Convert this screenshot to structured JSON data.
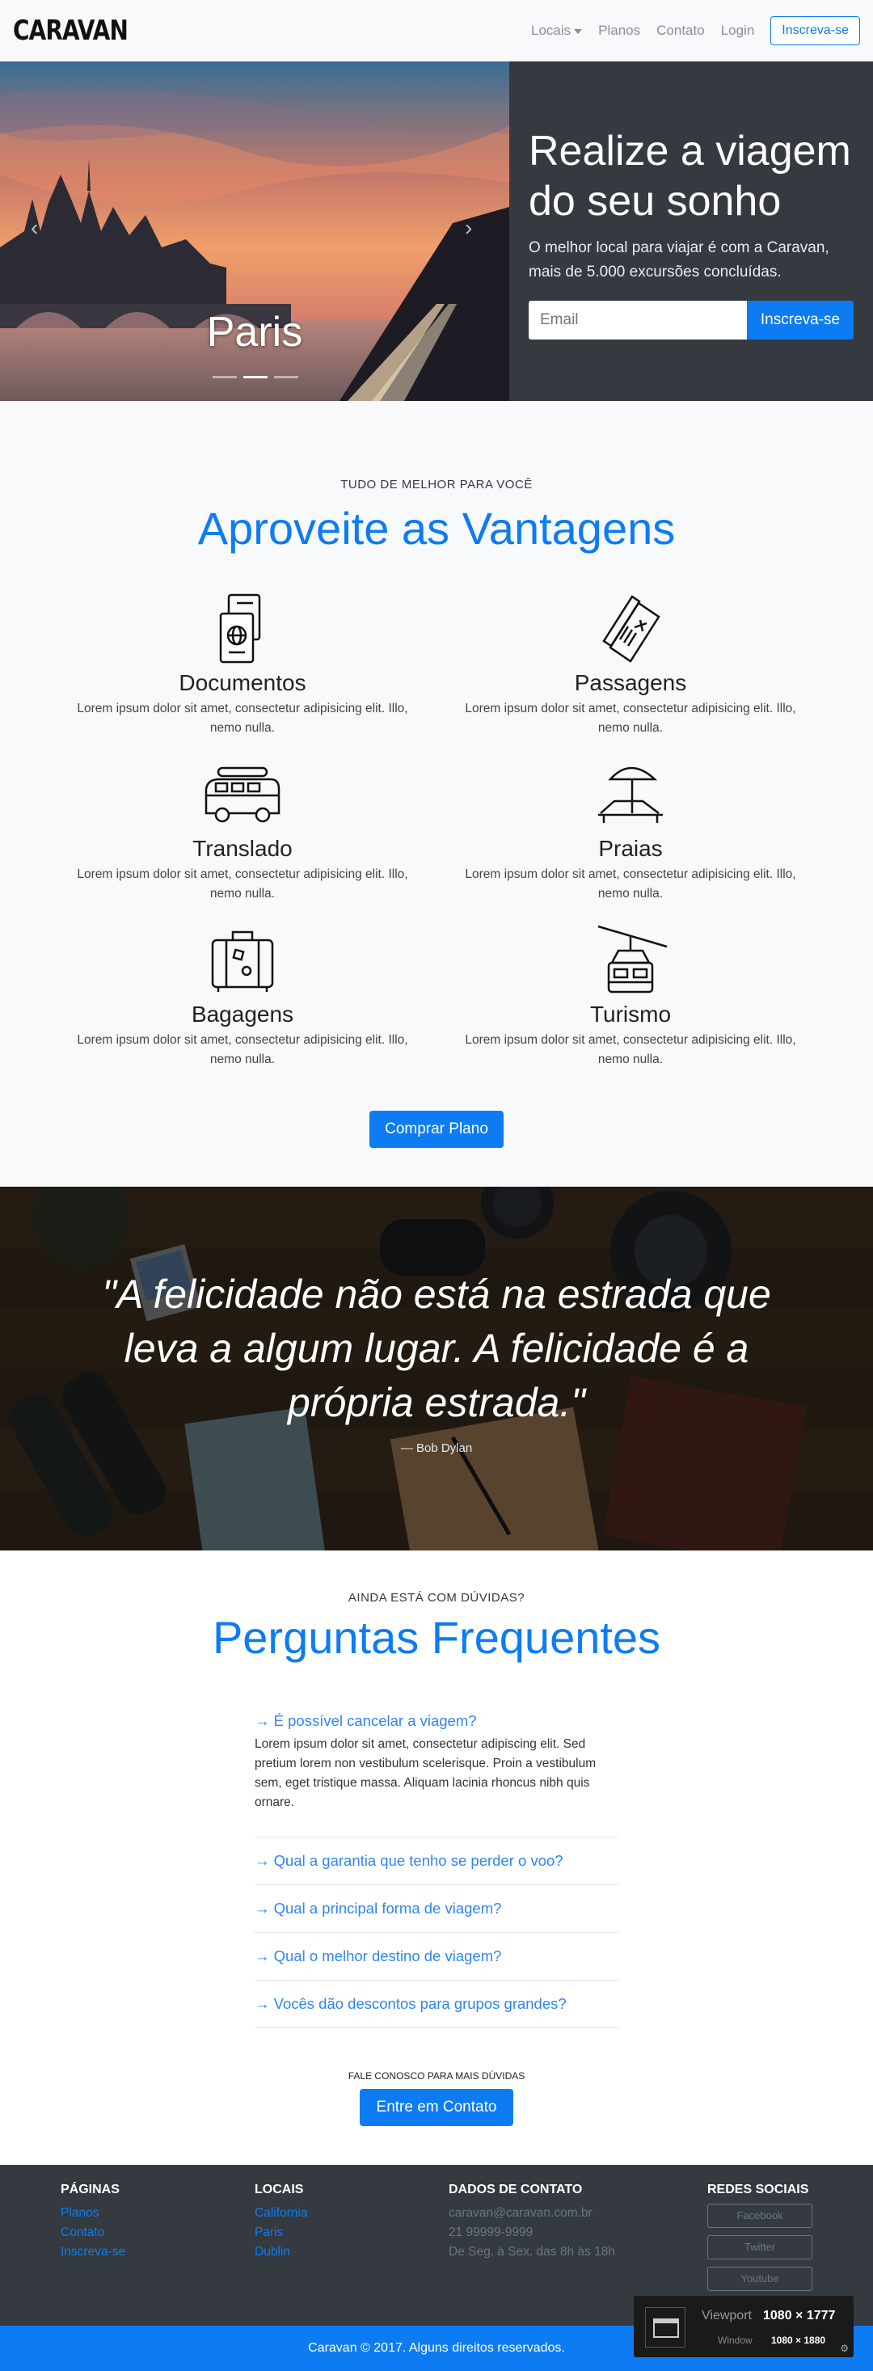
{
  "navbar": {
    "brand": "CARAVAN",
    "links": [
      "Locais",
      "Planos",
      "Contato",
      "Login"
    ],
    "cta": "Inscreva-se"
  },
  "hero": {
    "carousel_caption": "Paris",
    "title": "Realize a viagem do seu sonho",
    "subtitle": "O melhor local para viajar é com a Caravan, mais de 5.000 excursões concluídas.",
    "email_placeholder": "Email",
    "signup_button": "Inscreva-se",
    "active_slide": 2,
    "slide_count": 3
  },
  "features": {
    "tag": "TUDO DE MELHOR PARA VOCÊ",
    "title": "Aproveite as Vantagens",
    "items": [
      {
        "title": "Documentos",
        "text": "Lorem ipsum dolor sit amet, consectetur adipisicing elit. Illo, nemo nulla.",
        "icon": "passport-icon"
      },
      {
        "title": "Passagens",
        "text": "Lorem ipsum dolor sit amet, consectetur adipisicing elit. Illo, nemo nulla.",
        "icon": "ticket-icon"
      },
      {
        "title": "Translado",
        "text": "Lorem ipsum dolor sit amet, consectetur adipisicing elit. Illo, nemo nulla.",
        "icon": "van-icon"
      },
      {
        "title": "Praias",
        "text": "Lorem ipsum dolor sit amet, consectetur adipisicing elit. Illo, nemo nulla.",
        "icon": "beach-icon"
      },
      {
        "title": "Bagagens",
        "text": "Lorem ipsum dolor sit amet, consectetur adipisicing elit. Illo, nemo nulla.",
        "icon": "suitcase-icon"
      },
      {
        "title": "Turismo",
        "text": "Lorem ipsum dolor sit amet, consectetur adipisicing elit. Illo, nemo nulla.",
        "icon": "cable-car-icon"
      }
    ],
    "button": "Comprar Plano"
  },
  "quote": {
    "text": "\"A felicidade não está na estrada que leva a algum lugar. A felicidade é a própria estrada.\"",
    "author": "— Bob Dylan"
  },
  "faq": {
    "tag": "AINDA ESTÁ COM DÚVIDAS?",
    "title": "Perguntas Frequentes",
    "items": [
      {
        "q": "→ É possível cancelar a viagem?",
        "a": "Lorem ipsum dolor sit amet, consectetur adipiscing elit. Sed pretium lorem non vestibulum scelerisque. Proin a vestibulum sem, eget tristique massa. Aliquam lacinia rhoncus nibh quis ornare."
      },
      {
        "q": "→ Qual a garantia que tenho se perder o voo?",
        "a": ""
      },
      {
        "q": "→ Qual a principal forma de viagem?",
        "a": ""
      },
      {
        "q": "→ Qual o melhor destino de viagem?",
        "a": ""
      },
      {
        "q": "→ Vocês dão descontos para grupos grandes?",
        "a": ""
      }
    ],
    "contact_tag": "FALE CONOSCO PARA MAIS DÚVIDAS",
    "contact_button": "Entre em Contato"
  },
  "footer": {
    "pages": {
      "title": "PÁGINAS",
      "links": [
        "Planos",
        "Contato",
        "Inscreva-se"
      ]
    },
    "locations": {
      "title": "LOCAIS",
      "links": [
        "California",
        "Paris",
        "Dublin"
      ]
    },
    "contact": {
      "title": "DADOS DE CONTATO",
      "lines": [
        "caravan@caravan.com.br",
        "21 99999-9999",
        "De Seg. à Sex. das 8h às 18h"
      ]
    },
    "social": {
      "title": "REDES SOCIAIS",
      "links": [
        "Facebook",
        "Twitter",
        "Youtube"
      ]
    },
    "copyright": "Caravan © 2017. Alguns direitos reservados."
  },
  "viewport_overlay": {
    "viewport_label": "Viewport",
    "viewport_value": "1080 × 1777",
    "window_label": "Window",
    "window_value": "1080 × 1880"
  },
  "colors": {
    "primary": "#0d7cf2",
    "dark": "#343a40",
    "light": "#f8f9fa"
  }
}
